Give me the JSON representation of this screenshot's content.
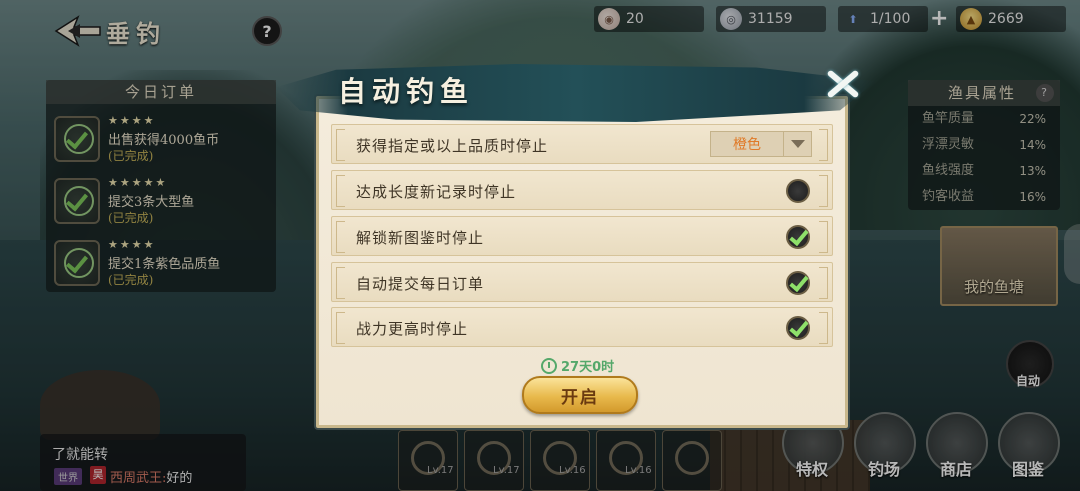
{
  "header": {
    "title": "垂钓",
    "help": "?"
  },
  "resources": [
    {
      "icon": "pearl-shell-icon",
      "value": "20"
    },
    {
      "icon": "silver-coin-icon",
      "value": "31159"
    },
    {
      "icon": "stamina-arrow-icon",
      "value": "1/100"
    },
    {
      "icon": "gold-ingot-icon",
      "value": "2669"
    }
  ],
  "resources_plus": "+",
  "orders": {
    "title": "今日订单",
    "items": [
      {
        "stars": "★★★★",
        "text": "出售获得4000鱼币",
        "status": "(已完成)"
      },
      {
        "stars": "★★★★★",
        "text": "提交3条大型鱼",
        "status": "(已完成)"
      },
      {
        "stars": "★★★★",
        "text": "提交1条紫色品质鱼",
        "status": "(已完成)"
      }
    ]
  },
  "gear_attrs": {
    "title": "渔具属性",
    "help": "?",
    "rows": [
      {
        "label": "鱼竿质量",
        "value": "22%"
      },
      {
        "label": "浮漂灵敏",
        "value": "14%"
      },
      {
        "label": "鱼线强度",
        "value": "13%"
      },
      {
        "label": "钓客收益",
        "value": "16%"
      }
    ]
  },
  "pond": {
    "label": "我的鱼塘"
  },
  "auto_button": {
    "label": "自动"
  },
  "dock": [
    {
      "icon": "privilege-icon",
      "label": "特权"
    },
    {
      "icon": "fishing-spot-icon",
      "label": "钓场"
    },
    {
      "icon": "shop-icon",
      "label": "商店"
    },
    {
      "icon": "catalog-icon",
      "label": "图鉴"
    }
  ],
  "tools": [
    {
      "icon": "rod-icon",
      "level": "Lv.17"
    },
    {
      "icon": "float-icon",
      "level": "Lv.17"
    },
    {
      "icon": "reel-icon",
      "level": "Lv.16"
    },
    {
      "icon": "hook-icon",
      "level": "Lv.16"
    },
    {
      "icon": "bait-icon",
      "level": ""
    }
  ],
  "chat": {
    "line1": "了就能转",
    "channel": "世界",
    "badge": "昊",
    "sender": "西周武王:",
    "message": "好的"
  },
  "modal": {
    "title": "自动钓鱼",
    "options": [
      {
        "label": "获得指定或以上品质时停止",
        "type": "dropdown",
        "value": "橙色"
      },
      {
        "label": "达成长度新记录时停止",
        "type": "checkbox",
        "checked": false
      },
      {
        "label": "解锁新图鉴时停止",
        "type": "checkbox",
        "checked": true
      },
      {
        "label": "自动提交每日订单",
        "type": "checkbox",
        "checked": true
      },
      {
        "label": "战力更高时停止",
        "type": "checkbox",
        "checked": true
      }
    ],
    "timer": "27天0时",
    "start_label": "开启"
  },
  "colors": {
    "accent_orange": "#e07a28",
    "check_green": "#8ee06a",
    "timer_green": "#55a86a",
    "start_gold": "#e8b94c"
  }
}
